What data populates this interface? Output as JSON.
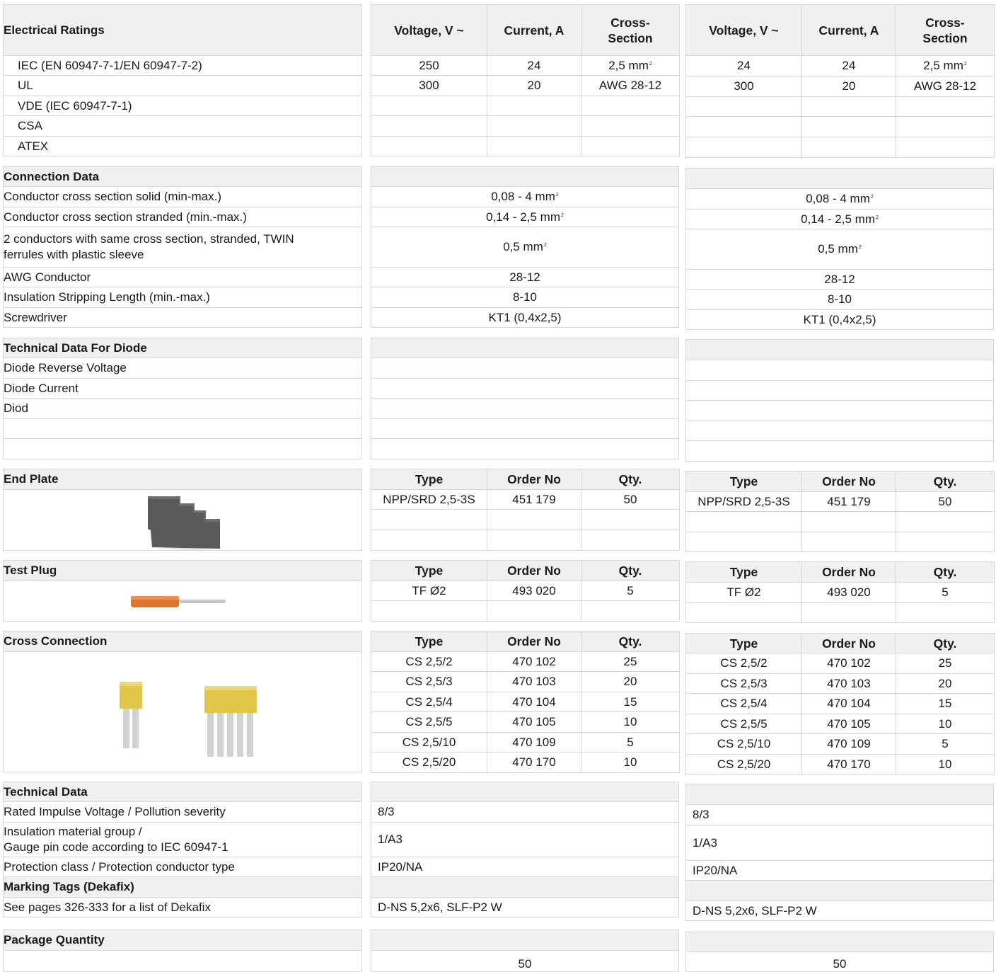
{
  "electrical_ratings": {
    "title": "Electrical Ratings",
    "col_voltage": "Voltage, V ~",
    "col_current": "Current, A",
    "col_cross_section": "Cross-\nSection",
    "rows": [
      {
        "label": "IEC (EN 60947-7-1/EN 60947-7-2)",
        "voltage": "250",
        "voltage_b": "24",
        "current": "24",
        "cross_section": "2,5 mm",
        "unit_sup": "2"
      },
      {
        "label": "UL",
        "voltage": "300",
        "voltage_b": "300",
        "current": "20",
        "cross_section": "AWG 28-12"
      },
      {
        "label": "VDE (IEC 60947-7-1)"
      },
      {
        "label": "CSA"
      },
      {
        "label": "ATEX"
      }
    ]
  },
  "connection_data": {
    "title": "Connection Data",
    "rows": [
      {
        "label": "Conductor cross section solid (min-max.)",
        "value": "0,08 - 4 mm",
        "sup": "2"
      },
      {
        "label": "Conductor cross section stranded (min.-max.)",
        "value": "0,14 - 2,5 mm",
        "sup": "2"
      },
      {
        "label": "2 conductors with same cross section, stranded, TWIN ferrules with plastic sleeve",
        "value": "0,5 mm",
        "sup": "2"
      },
      {
        "label": "AWG Conductor",
        "value": "28-12"
      },
      {
        "label": "Insulation Stripping Length (min.-max.)",
        "value": "8-10"
      },
      {
        "label": "Screwdriver",
        "value": "KT1 (0,4x2,5)"
      }
    ]
  },
  "diode_data": {
    "title": "Technical Data For Diode",
    "rows": [
      "Diode  Reverse Voltage",
      "Diode  Current",
      "Diod",
      "",
      ""
    ]
  },
  "accessory_columns": {
    "type": "Type",
    "order_no": "Order No",
    "qty": "Qty."
  },
  "end_plate": {
    "title": "End Plate",
    "rows": [
      {
        "type": "NPP/SRD 2,5-3S",
        "order_no": "451 179",
        "qty": "50"
      }
    ]
  },
  "test_plug": {
    "title": "Test Plug",
    "rows": [
      {
        "type": "TF Ø2",
        "order_no": "493 020",
        "qty": "5"
      }
    ]
  },
  "cross_connection": {
    "title": "Cross Connection",
    "rows": [
      {
        "type": "CS 2,5/2",
        "order_no": "470 102",
        "qty": "25"
      },
      {
        "type": "CS 2,5/3",
        "order_no": "470 103",
        "qty": "20"
      },
      {
        "type": "CS 2,5/4",
        "order_no": "470 104",
        "qty": "15"
      },
      {
        "type": "CS 2,5/5",
        "order_no": "470 105",
        "qty": "10"
      },
      {
        "type": "CS 2,5/10",
        "order_no": "470 109",
        "qty": "5"
      },
      {
        "type": "CS 2,5/20",
        "order_no": "470 170",
        "qty": "10"
      }
    ]
  },
  "technical_data": {
    "title": "Technical Data",
    "rows": [
      {
        "label": "Rated Impulse Voltage / Pollution severity",
        "value": "8/3"
      },
      {
        "label": "Insulation material group /\nGauge pin code according to IEC 60947-1",
        "value": "1/A3"
      },
      {
        "label": "Protection class / Protection conductor type",
        "value": "IP20/NA"
      }
    ]
  },
  "marking_tags": {
    "title": "Marking Tags (Dekafix)",
    "label": "See pages 326-333 for a list of Dekafix",
    "value": "D-NS 5,2x6,  SLF-P2 W"
  },
  "package_quantity": {
    "title": "Package Quantity",
    "value": "50"
  },
  "colors": {
    "border": "#d6d6d6",
    "header_fill": "#f0f0f0",
    "end_plate": "#5a5a5a",
    "test_plug": "#e0762e",
    "cross_connection": "#e2c64a"
  }
}
